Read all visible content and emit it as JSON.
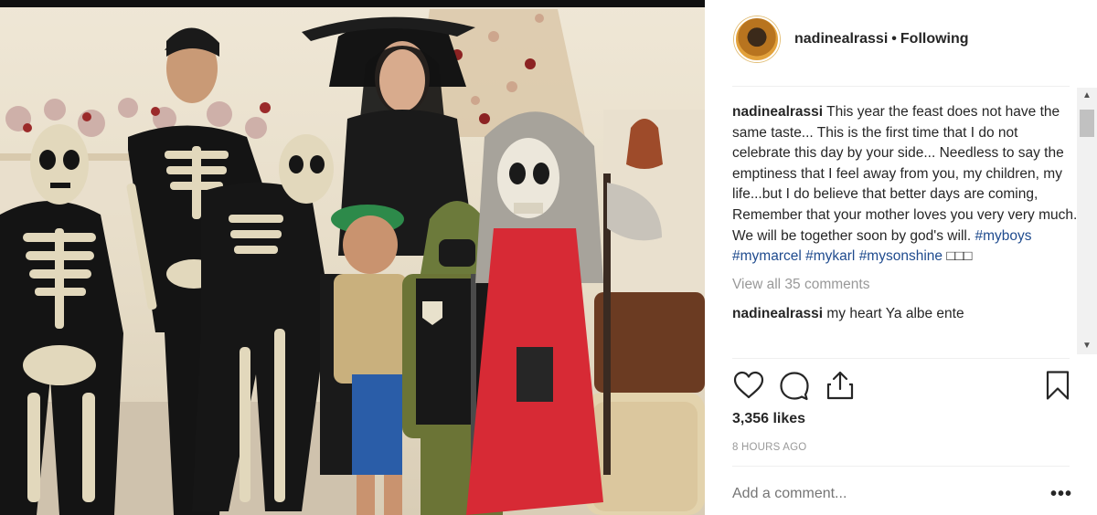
{
  "post": {
    "username": "nadinealrassi",
    "separator": "•",
    "follow_status": "Following",
    "caption_username": "nadinealrassi",
    "caption_text": " This year the feast does not have the same taste... This is the first time that I do not celebrate this day by your side... Needless to say the emptiness that I feel away from you, my children, my life...but I do believe that better days are coming, Remember that your mother loves you very very much. We will be together soon by god's will. ",
    "hashtags": [
      "#myboys",
      "#mymarcel",
      "#mykarl",
      "#mysonshine"
    ],
    "caption_trailing": " □□□",
    "view_all_comments": "View all 35 comments",
    "partial_comment_user": "nadinealrassi",
    "partial_comment_text": " my heart Ya albe ente",
    "likes": "3,356 likes",
    "timestamp": "8 HOURS AGO",
    "add_comment_placeholder": "Add a comment...",
    "more_options": "•••"
  },
  "icons": {
    "like": "heart-icon",
    "comment": "comment-bubble-icon",
    "share": "share-icon",
    "save": "bookmark-icon",
    "scroll_up": "scroll-up-arrow-icon",
    "scroll_down": "scroll-down-arrow-icon"
  },
  "colors": {
    "text": "#262626",
    "muted": "#999999",
    "hashtag": "#1f4b8e",
    "divider": "#efefef"
  }
}
